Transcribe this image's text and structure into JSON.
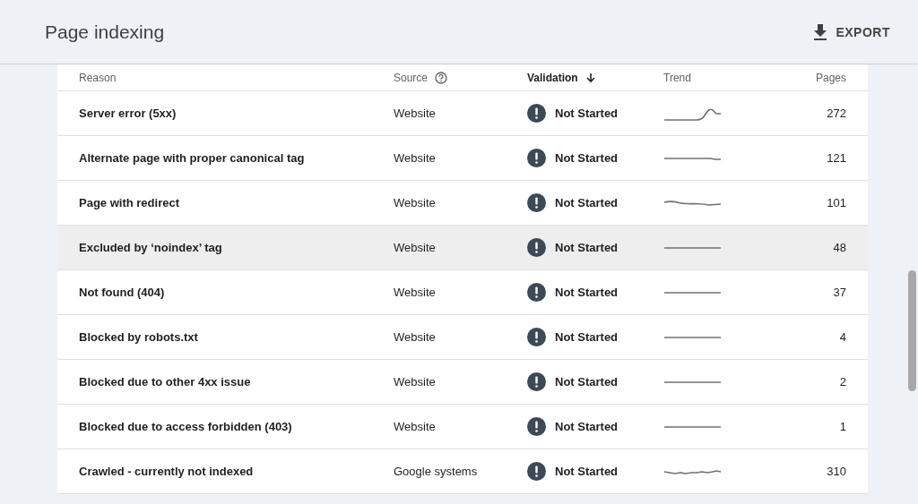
{
  "header": {
    "title": "Page indexing",
    "export_label": "EXPORT"
  },
  "table": {
    "columns": [
      {
        "label": "Reason",
        "kind": "plain"
      },
      {
        "label": "Source",
        "kind": "help"
      },
      {
        "label": "Validation",
        "kind": "sorted"
      },
      {
        "label": "Trend",
        "kind": "plain"
      },
      {
        "label": "Pages",
        "kind": "plain"
      }
    ],
    "rows": [
      {
        "reason": "Server error (5xx)",
        "source": "Website",
        "validation": "Not Started",
        "pages": "272",
        "highlighted": false
      },
      {
        "reason": "Alternate page with proper canonical tag",
        "source": "Website",
        "validation": "Not Started",
        "pages": "121",
        "highlighted": false
      },
      {
        "reason": "Page with redirect",
        "source": "Website",
        "validation": "Not Started",
        "pages": "101",
        "highlighted": false
      },
      {
        "reason": "Excluded by ‘noindex’ tag",
        "source": "Website",
        "validation": "Not Started",
        "pages": "48",
        "highlighted": true
      },
      {
        "reason": "Not found (404)",
        "source": "Website",
        "validation": "Not Started",
        "pages": "37",
        "highlighted": false
      },
      {
        "reason": "Blocked by robots.txt",
        "source": "Website",
        "validation": "Not Started",
        "pages": "4",
        "highlighted": false
      },
      {
        "reason": "Blocked due to other 4xx issue",
        "source": "Website",
        "validation": "Not Started",
        "pages": "2",
        "highlighted": false
      },
      {
        "reason": "Blocked due to access forbidden (403)",
        "source": "Website",
        "validation": "Not Started",
        "pages": "1",
        "highlighted": false
      },
      {
        "reason": "Crawled - currently not indexed",
        "source": "Google systems",
        "validation": "Not Started",
        "pages": "310",
        "highlighted": false
      }
    ]
  }
}
